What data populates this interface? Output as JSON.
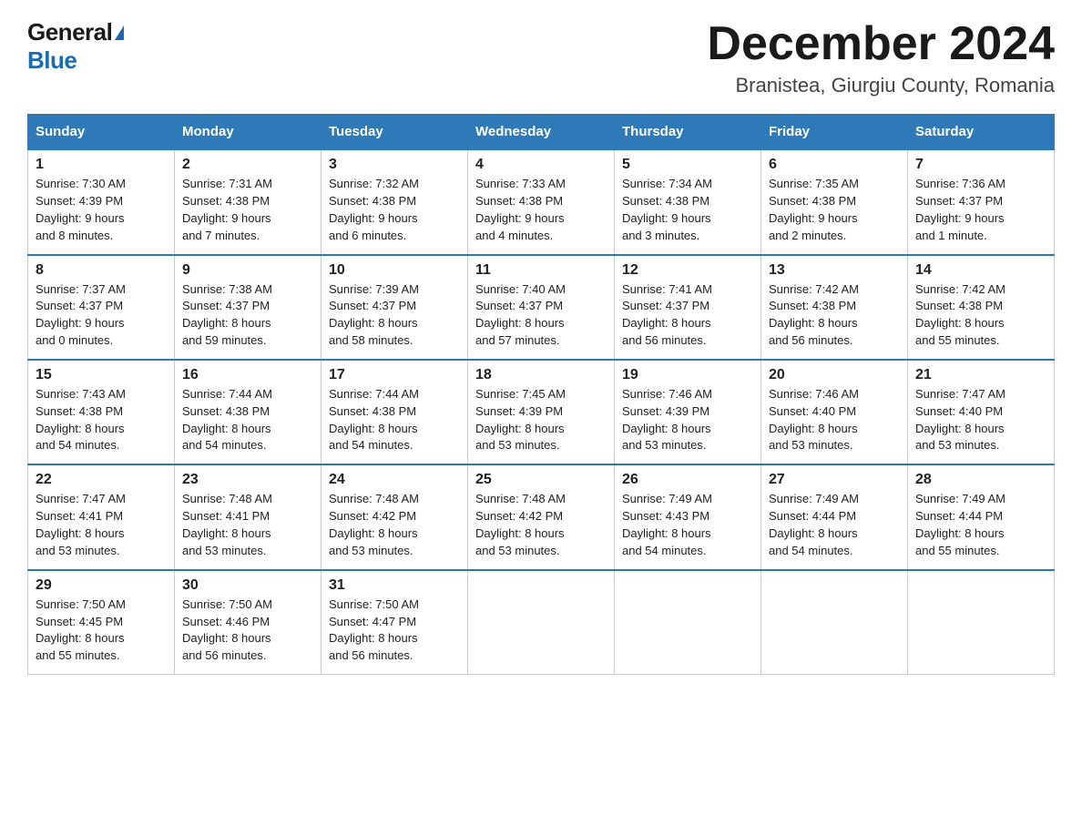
{
  "header": {
    "logo_general": "General",
    "logo_blue": "Blue",
    "main_title": "December 2024",
    "subtitle": "Branistea, Giurgiu County, Romania"
  },
  "columns": [
    "Sunday",
    "Monday",
    "Tuesday",
    "Wednesday",
    "Thursday",
    "Friday",
    "Saturday"
  ],
  "weeks": [
    [
      {
        "day": "1",
        "info": "Sunrise: 7:30 AM\nSunset: 4:39 PM\nDaylight: 9 hours\nand 8 minutes."
      },
      {
        "day": "2",
        "info": "Sunrise: 7:31 AM\nSunset: 4:38 PM\nDaylight: 9 hours\nand 7 minutes."
      },
      {
        "day": "3",
        "info": "Sunrise: 7:32 AM\nSunset: 4:38 PM\nDaylight: 9 hours\nand 6 minutes."
      },
      {
        "day": "4",
        "info": "Sunrise: 7:33 AM\nSunset: 4:38 PM\nDaylight: 9 hours\nand 4 minutes."
      },
      {
        "day": "5",
        "info": "Sunrise: 7:34 AM\nSunset: 4:38 PM\nDaylight: 9 hours\nand 3 minutes."
      },
      {
        "day": "6",
        "info": "Sunrise: 7:35 AM\nSunset: 4:38 PM\nDaylight: 9 hours\nand 2 minutes."
      },
      {
        "day": "7",
        "info": "Sunrise: 7:36 AM\nSunset: 4:37 PM\nDaylight: 9 hours\nand 1 minute."
      }
    ],
    [
      {
        "day": "8",
        "info": "Sunrise: 7:37 AM\nSunset: 4:37 PM\nDaylight: 9 hours\nand 0 minutes."
      },
      {
        "day": "9",
        "info": "Sunrise: 7:38 AM\nSunset: 4:37 PM\nDaylight: 8 hours\nand 59 minutes."
      },
      {
        "day": "10",
        "info": "Sunrise: 7:39 AM\nSunset: 4:37 PM\nDaylight: 8 hours\nand 58 minutes."
      },
      {
        "day": "11",
        "info": "Sunrise: 7:40 AM\nSunset: 4:37 PM\nDaylight: 8 hours\nand 57 minutes."
      },
      {
        "day": "12",
        "info": "Sunrise: 7:41 AM\nSunset: 4:37 PM\nDaylight: 8 hours\nand 56 minutes."
      },
      {
        "day": "13",
        "info": "Sunrise: 7:42 AM\nSunset: 4:38 PM\nDaylight: 8 hours\nand 56 minutes."
      },
      {
        "day": "14",
        "info": "Sunrise: 7:42 AM\nSunset: 4:38 PM\nDaylight: 8 hours\nand 55 minutes."
      }
    ],
    [
      {
        "day": "15",
        "info": "Sunrise: 7:43 AM\nSunset: 4:38 PM\nDaylight: 8 hours\nand 54 minutes."
      },
      {
        "day": "16",
        "info": "Sunrise: 7:44 AM\nSunset: 4:38 PM\nDaylight: 8 hours\nand 54 minutes."
      },
      {
        "day": "17",
        "info": "Sunrise: 7:44 AM\nSunset: 4:38 PM\nDaylight: 8 hours\nand 54 minutes."
      },
      {
        "day": "18",
        "info": "Sunrise: 7:45 AM\nSunset: 4:39 PM\nDaylight: 8 hours\nand 53 minutes."
      },
      {
        "day": "19",
        "info": "Sunrise: 7:46 AM\nSunset: 4:39 PM\nDaylight: 8 hours\nand 53 minutes."
      },
      {
        "day": "20",
        "info": "Sunrise: 7:46 AM\nSunset: 4:40 PM\nDaylight: 8 hours\nand 53 minutes."
      },
      {
        "day": "21",
        "info": "Sunrise: 7:47 AM\nSunset: 4:40 PM\nDaylight: 8 hours\nand 53 minutes."
      }
    ],
    [
      {
        "day": "22",
        "info": "Sunrise: 7:47 AM\nSunset: 4:41 PM\nDaylight: 8 hours\nand 53 minutes."
      },
      {
        "day": "23",
        "info": "Sunrise: 7:48 AM\nSunset: 4:41 PM\nDaylight: 8 hours\nand 53 minutes."
      },
      {
        "day": "24",
        "info": "Sunrise: 7:48 AM\nSunset: 4:42 PM\nDaylight: 8 hours\nand 53 minutes."
      },
      {
        "day": "25",
        "info": "Sunrise: 7:48 AM\nSunset: 4:42 PM\nDaylight: 8 hours\nand 53 minutes."
      },
      {
        "day": "26",
        "info": "Sunrise: 7:49 AM\nSunset: 4:43 PM\nDaylight: 8 hours\nand 54 minutes."
      },
      {
        "day": "27",
        "info": "Sunrise: 7:49 AM\nSunset: 4:44 PM\nDaylight: 8 hours\nand 54 minutes."
      },
      {
        "day": "28",
        "info": "Sunrise: 7:49 AM\nSunset: 4:44 PM\nDaylight: 8 hours\nand 55 minutes."
      }
    ],
    [
      {
        "day": "29",
        "info": "Sunrise: 7:50 AM\nSunset: 4:45 PM\nDaylight: 8 hours\nand 55 minutes."
      },
      {
        "day": "30",
        "info": "Sunrise: 7:50 AM\nSunset: 4:46 PM\nDaylight: 8 hours\nand 56 minutes."
      },
      {
        "day": "31",
        "info": "Sunrise: 7:50 AM\nSunset: 4:47 PM\nDaylight: 8 hours\nand 56 minutes."
      },
      null,
      null,
      null,
      null
    ]
  ]
}
